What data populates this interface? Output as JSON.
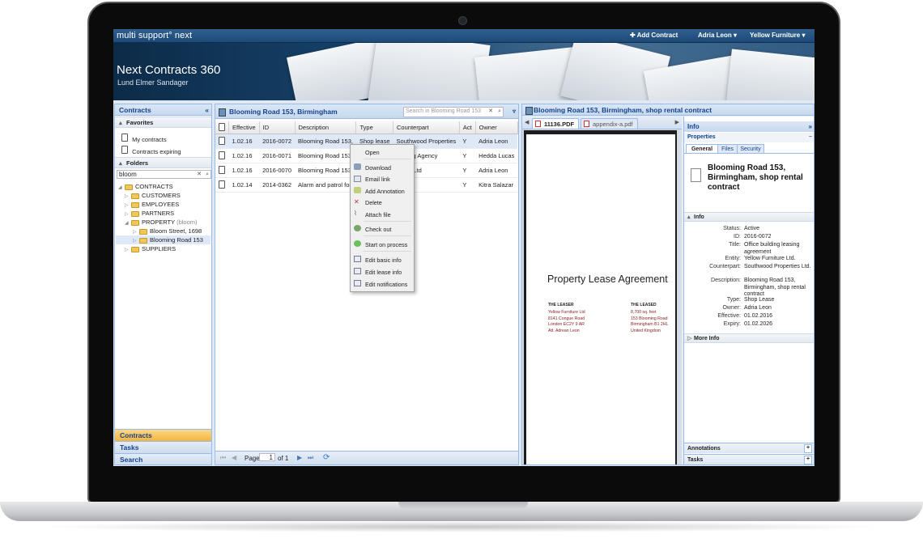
{
  "brand": "multi support° next",
  "topbar": {
    "add_contract": "Add Contract",
    "user": "Adria Leon",
    "company": "Yellow Furniture"
  },
  "app": {
    "title": "Next Contracts 360",
    "subtitle": "Lund Elmer Sandager"
  },
  "left": {
    "title": "Contracts",
    "favorites_label": "Favorites",
    "favorites": [
      "My contracts",
      "Contracts expiring"
    ],
    "folders_label": "Folders",
    "search_value": "bloom",
    "tree": {
      "root": "CONTRACTS",
      "customers": "CUSTOMERS",
      "employees": "EMPLOYEES",
      "partners": "PARTNERS",
      "property": "PROPERTY",
      "property_hint": "(bloom)",
      "bloom_street": "Bloom Street, 1698",
      "blooming_road": "Blooming Road 153",
      "suppliers": "SUPPLIERS"
    },
    "nav": [
      "Contracts",
      "Tasks",
      "Search"
    ]
  },
  "grid": {
    "title": "Blooming Road 153, Birmingham",
    "search_placeholder": "Search in Blooming Road 153",
    "columns": [
      "Effective",
      "ID",
      "Description",
      "Type",
      "Counterpart",
      "Act",
      "Owner"
    ],
    "rows": [
      [
        "1.02.16",
        "2016-0072",
        "Blooming Road 153,",
        "Shop lease",
        "Southwood Properties",
        "Y",
        "Adria Leon"
      ],
      [
        "1.02.16",
        "2016-0071",
        "Blooming Road 153,",
        "",
        "leaning Agency",
        "Y",
        "Hedda Lucas"
      ],
      [
        "1.02.16",
        "2016-0070",
        "Blooming Road 153,",
        "",
        "nergy Ltd",
        "Y",
        "Adria Leon"
      ],
      [
        "1.02.14",
        "2014-0362",
        "Alarm and patrol for",
        "",
        "rities",
        "Y",
        "Kitra Salazar"
      ]
    ],
    "pager": {
      "page_label": "Page",
      "page_value": "1",
      "of": "of 1"
    }
  },
  "context_menu": [
    "Open",
    "Download",
    "Email link",
    "Add Annotation",
    "Delete",
    "Attach file",
    "Check out",
    "Start on process",
    "Edit basic info",
    "Edit lease info",
    "Edit notifications"
  ],
  "viewer": {
    "title": "Blooming Road 153, Birmingham, shop rental contract",
    "tabs": [
      "11136.PDF",
      "appendix-a.pdf"
    ],
    "doc_title": "Property Lease Agreement",
    "leaser_label": "THE LEASER",
    "leaser_lines": [
      "Yellow Furniture Ltd",
      "8141 Congue Road",
      "London EC2Y 9 AR",
      "Att. Adrean Leon"
    ],
    "leased_label": "THE LEASED",
    "leased_lines": [
      "8,700 sq. feet",
      "153 Blooming Road",
      "Birmingham B1 2HL",
      "United Kingdom"
    ]
  },
  "info": {
    "title": "Info",
    "properties_label": "Properties",
    "tabs": [
      "General",
      "Files",
      "Security"
    ],
    "doc_heading": "Blooming Road 153, Birmingham, shop rental contract",
    "section_info": "Info",
    "fields": [
      {
        "label": "Status:",
        "value": "Active"
      },
      {
        "label": "ID:",
        "value": "2016-0072"
      },
      {
        "label": "Title:",
        "value": "Office building leasing agreement"
      },
      {
        "label": "Entity:",
        "value": "Yellow Furniture Ltd."
      },
      {
        "label": "Counterpart:",
        "value": "Southwood Properties Ltd."
      },
      {
        "label": "Description:",
        "value": "Blooming Road 153, Birmingham, shop rental contract"
      },
      {
        "label": "Type:",
        "value": "Shop Lease"
      },
      {
        "label": "Owner:",
        "value": "Adria Leon"
      },
      {
        "label": "Effective:",
        "value": "01.02.2016"
      },
      {
        "label": "Expiry:",
        "value": "01.02.2026"
      }
    ],
    "more_info": "More Info",
    "annotations": "Annotations",
    "tasks": "Tasks"
  }
}
